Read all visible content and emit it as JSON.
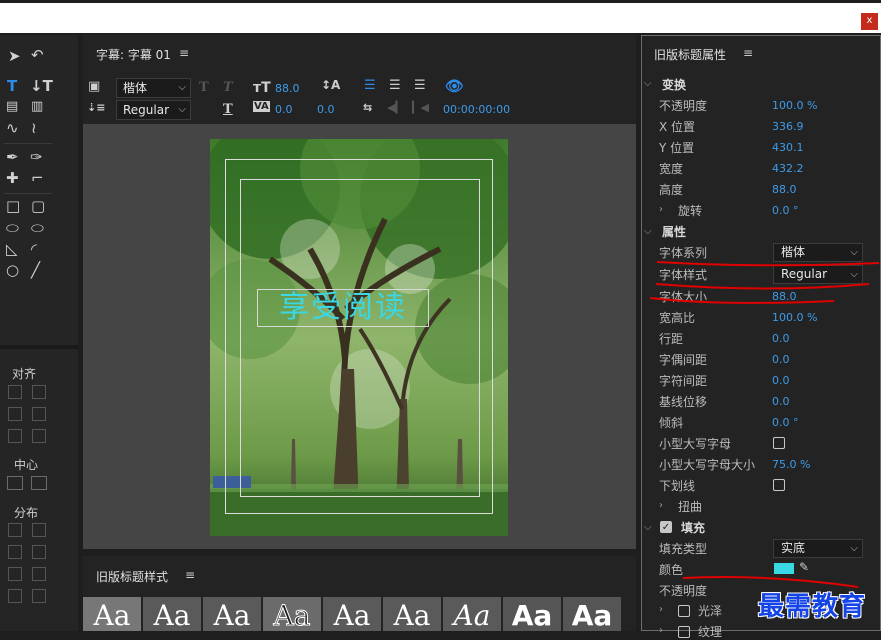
{
  "window": {
    "close_label": "x"
  },
  "tools_panel": {
    "align_label": "对齐",
    "center_label": "中心",
    "distribute_label": "分布"
  },
  "title_panel": {
    "header": "字幕: 字幕 01",
    "font_family": "楷体",
    "font_style": "Regular",
    "font_size": "88.0",
    "kerning": "0.0",
    "tracking": "0.0",
    "timecode": "00:00:00:00",
    "title_text": "享受阅读"
  },
  "styles_panel": {
    "header": "旧版标题样式",
    "swatch_label": "Aa"
  },
  "properties_panel": {
    "header": "旧版标题属性",
    "transform": {
      "label": "变换",
      "opacity": {
        "label": "不透明度",
        "value": "100.0 %"
      },
      "x": {
        "label": "X 位置",
        "value": "336.9"
      },
      "y": {
        "label": "Y 位置",
        "value": "430.1"
      },
      "width": {
        "label": "宽度",
        "value": "432.2"
      },
      "height": {
        "label": "高度",
        "value": "88.0"
      },
      "rotation": {
        "label": "旋转",
        "value": "0.0 °"
      }
    },
    "properties": {
      "label": "属性",
      "font_family": {
        "label": "字体系列",
        "value": "楷体"
      },
      "font_style": {
        "label": "字体样式",
        "value": "Regular"
      },
      "font_size": {
        "label": "字体大小",
        "value": "88.0"
      },
      "aspect": {
        "label": "宽高比",
        "value": "100.0 %"
      },
      "leading": {
        "label": "行距",
        "value": "0.0"
      },
      "kerning": {
        "label": "字偶间距",
        "value": "0.0"
      },
      "tracking": {
        "label": "字符间距",
        "value": "0.0"
      },
      "baseline": {
        "label": "基线位移",
        "value": "0.0"
      },
      "slant": {
        "label": "倾斜",
        "value": "0.0 °"
      },
      "small_caps": {
        "label": "小型大写字母"
      },
      "small_caps_size": {
        "label": "小型大写字母大小",
        "value": "75.0 %"
      },
      "underline": {
        "label": "下划线"
      },
      "distort": {
        "label": "扭曲"
      }
    },
    "fill": {
      "label": "填充",
      "fill_type": {
        "label": "填充类型",
        "value": "实底"
      },
      "color": {
        "label": "颜色",
        "swatch": "#3ad7e4"
      },
      "opacity": {
        "label": "不透明度"
      },
      "sheen": {
        "label": "光泽"
      },
      "texture": {
        "label": "纹理"
      }
    }
  },
  "watermark": "最需教育",
  "colors": {
    "accent": "#3d9be9",
    "fill_swatch": "#3ad7e4",
    "annotation": "#e00000"
  }
}
